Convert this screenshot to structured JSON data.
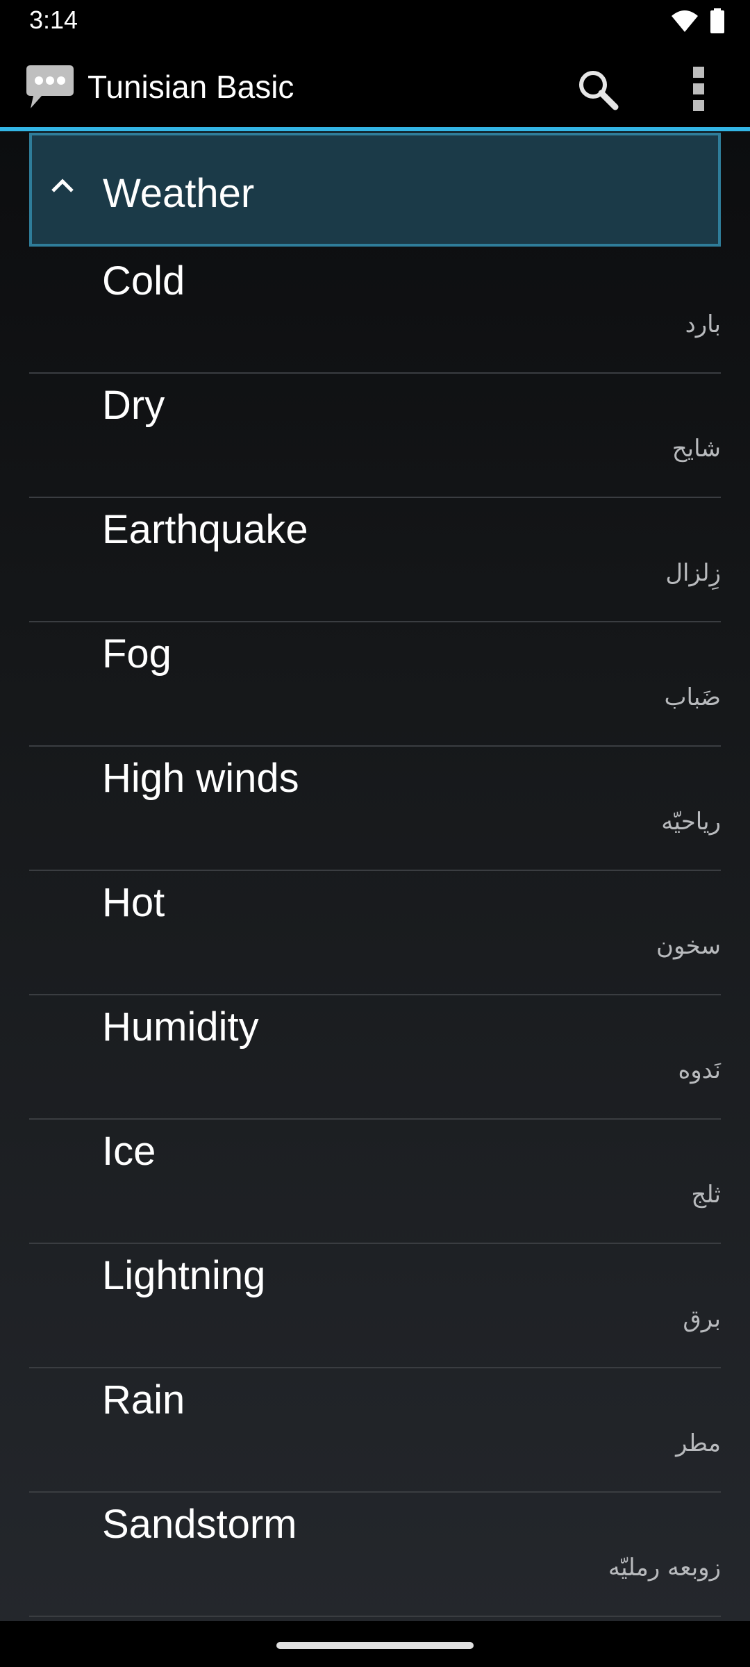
{
  "status_bar": {
    "time": "3:14"
  },
  "app_bar": {
    "title": "Tunisian Basic",
    "accent_color": "#33b5e5",
    "icons": [
      "chat-bubble-icon",
      "search-icon",
      "overflow-menu-icon"
    ]
  },
  "group": {
    "label": "Weather",
    "expanded": true
  },
  "items": [
    {
      "english": "Cold",
      "arabic": "بارد"
    },
    {
      "english": "Dry",
      "arabic": "شايح"
    },
    {
      "english": "Earthquake",
      "arabic": "زِلزال"
    },
    {
      "english": "Fog",
      "arabic": "ضَباب"
    },
    {
      "english": "High winds",
      "arabic": "رياحيّه"
    },
    {
      "english": "Hot",
      "arabic": "سخون"
    },
    {
      "english": "Humidity",
      "arabic": "نَدوه"
    },
    {
      "english": "Ice",
      "arabic": "ثلج"
    },
    {
      "english": "Lightning",
      "arabic": "برق"
    },
    {
      "english": "Rain",
      "arabic": "مطر"
    },
    {
      "english": "Sandstorm",
      "arabic": "زوبعه رمليّه"
    }
  ]
}
